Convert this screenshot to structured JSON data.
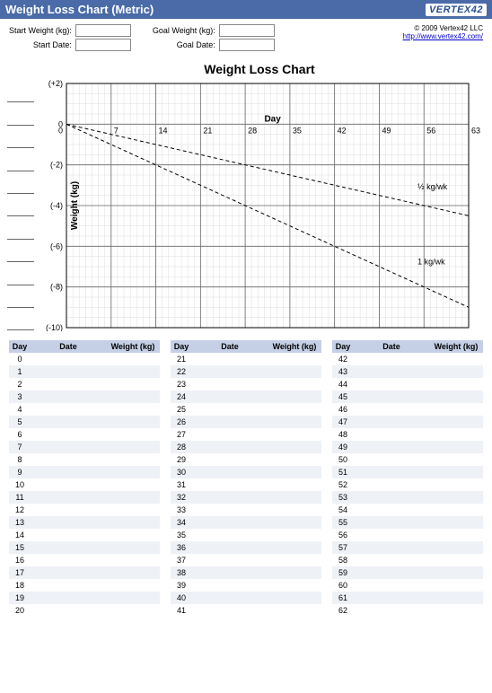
{
  "titlebar": {
    "title": "Weight Loss Chart (Metric)",
    "logo": "VERTEX42"
  },
  "inputs": {
    "start_weight_label": "Start Weight (kg):",
    "start_date_label": "Start Date:",
    "goal_weight_label": "Goal Weight (kg):",
    "goal_date_label": "Goal Date:",
    "start_weight": "",
    "start_date": "",
    "goal_weight": "",
    "goal_date": ""
  },
  "credits": {
    "copyright": "© 2009 Vertex42 LLC",
    "link": "http://www.vertex42.com/"
  },
  "chart": {
    "title": "Weight Loss Chart",
    "xlabel": "Day",
    "ylabel": "Weight (kg)",
    "annotations": {
      "half": "½ kg/wk",
      "full": "1 kg/wk"
    }
  },
  "chart_data": {
    "type": "line",
    "title": "Weight Loss Chart",
    "xlabel": "Day",
    "ylabel": "Weight (kg)",
    "xlim": [
      0,
      63
    ],
    "ylim": [
      -10,
      2
    ],
    "xticks": [
      0,
      7,
      14,
      21,
      28,
      35,
      42,
      49,
      56,
      63
    ],
    "yticks": [
      2,
      0,
      -2,
      -4,
      -6,
      -8,
      -10
    ],
    "ytick_labels": [
      "(+2)",
      "0",
      "(-2)",
      "(-4)",
      "(-6)",
      "(-8)",
      "(-10)"
    ],
    "series": [
      {
        "name": "½ kg/wk",
        "x": [
          0,
          63
        ],
        "y": [
          0,
          -4.5
        ]
      },
      {
        "name": "1 kg/wk",
        "x": [
          0,
          63
        ],
        "y": [
          0,
          -9
        ]
      }
    ],
    "blank_slots_left": 11
  },
  "tables": {
    "headers": {
      "day": "Day",
      "date": "Date",
      "weight": "Weight (kg)"
    },
    "cols": [
      [
        0,
        1,
        2,
        3,
        4,
        5,
        6,
        7,
        8,
        9,
        10,
        11,
        12,
        13,
        14,
        15,
        16,
        17,
        18,
        19,
        20
      ],
      [
        21,
        22,
        23,
        24,
        25,
        26,
        27,
        28,
        29,
        30,
        31,
        32,
        33,
        34,
        35,
        36,
        37,
        38,
        39,
        40,
        41
      ],
      [
        42,
        43,
        44,
        45,
        46,
        47,
        48,
        49,
        50,
        51,
        52,
        53,
        54,
        55,
        56,
        57,
        58,
        59,
        60,
        61,
        62
      ]
    ]
  }
}
